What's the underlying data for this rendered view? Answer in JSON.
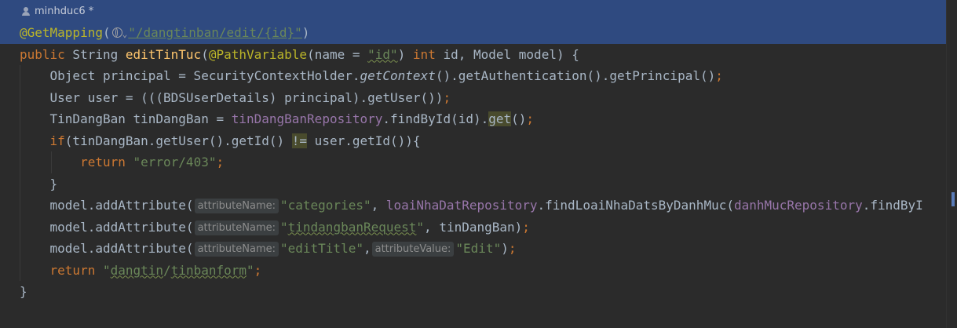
{
  "author": {
    "name": "minhduc6 *",
    "icon": "person-icon"
  },
  "code": {
    "line1": {
      "annotation": "@GetMapping",
      "open": "(",
      "chevron": "⌄",
      "path": "\"/dangtinban/edit/{id}\"",
      "close": ")"
    },
    "line2": {
      "kw_public": "public",
      "type": " String ",
      "method": "editTinTuc",
      "open": "(",
      "annotation": "@PathVariable",
      "args1": "(name = ",
      "str_id": "\"id\"",
      "args2": ") ",
      "kw_int": "int",
      "args3": " id, Model model) {"
    },
    "line3": {
      "a": "Object principal = SecurityContextHolder.",
      "italic": "getContext",
      "b": "().getAuthentication().getPrincipal()",
      "semi": ";"
    },
    "line4": {
      "a": "User user = (((BDSUserDetails) principal).getUser())",
      "semi": ";"
    },
    "line5": {
      "a": "TinDangBan tinDangBan = ",
      "field": "tinDangBanRepository",
      "b": ".findById(id).",
      "get": "get",
      "c": "()",
      "semi": ";"
    },
    "line6": {
      "kw_if": "if",
      "a": "(tinDangBan.getUser().getId() ",
      "op": "!=",
      "b": " user.getId()){"
    },
    "line7": {
      "kw_return": "return",
      "sp": " ",
      "str": "\"error/403\"",
      "semi": ";"
    },
    "line8": {
      "brace": "}"
    },
    "line9": {
      "a": "model.addAttribute(",
      "hint": "attributeName:",
      "str": "\"categories\"",
      "comma": ", ",
      "field1": "loaiNhaDatRepository",
      "b": ".findLoaiNhaDatsByDanhMuc(",
      "field2": "danhMucRepository",
      "c": ".findByI"
    },
    "line10": {
      "a": "model.addAttribute(",
      "hint": "attributeName:",
      "q1": "\"",
      "str": "tindangbanRequest",
      "q2": "\"",
      "b": ", tinDangBan)",
      "semi": ";"
    },
    "line11": {
      "a": "model.addAttribute(",
      "hint1": "attributeName:",
      "str1": "\"editTitle\"",
      "comma": ",",
      "hint2": "attributeValue:",
      "str2": "\"Edit\"",
      "b": ")",
      "semi": ";"
    },
    "line12": {
      "kw_return": "return",
      "sp": " ",
      "q1": "\"",
      "str_a": "dangtin",
      "slash": "/",
      "str_b": "tinbanform",
      "q2": "\"",
      "semi": ";"
    },
    "line13": {
      "brace": "}"
    }
  },
  "colors": {
    "background": "#2b2b2b",
    "current_line": "#2f4a80",
    "keyword": "#cc7832",
    "annotation": "#bbb529",
    "method": "#ffc66d",
    "string": "#6a8759",
    "field": "#9876aa",
    "text": "#a9b7c6"
  }
}
